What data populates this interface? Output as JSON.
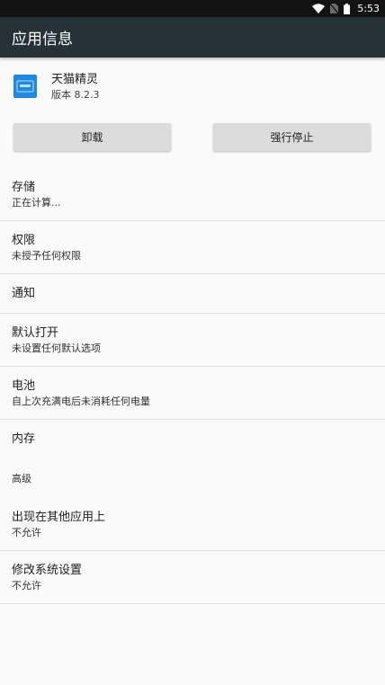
{
  "status_bar": {
    "time": "5:53",
    "icons": [
      "wifi-icon",
      "no-sim-icon",
      "battery-icon"
    ]
  },
  "app_bar": {
    "title": "应用信息"
  },
  "app": {
    "name": "天猫精灵",
    "version": "版本 8.2.3",
    "icon": "tmall-genie-icon",
    "icon_color": "#1e88e5"
  },
  "buttons": {
    "uninstall": "卸载",
    "force_stop": "强行停止"
  },
  "settings": {
    "storage": {
      "title": "存储",
      "subtitle": "正在计算..."
    },
    "permissions": {
      "title": "权限",
      "subtitle": "未授予任何权限"
    },
    "notifications": {
      "title": "通知"
    },
    "open_by_default": {
      "title": "默认打开",
      "subtitle": "未设置任何默认选项"
    },
    "battery": {
      "title": "电池",
      "subtitle": "自上次充满电后未消耗任何电量"
    },
    "memory": {
      "title": "内存"
    },
    "advanced": {
      "title": "高级"
    },
    "draw_over": {
      "title": "出现在其他应用上",
      "subtitle": "不允许"
    },
    "modify_system": {
      "title": "修改系统设置",
      "subtitle": "不允许"
    }
  },
  "colors": {
    "app_bar": "#263238",
    "status_bar": "#131313",
    "background": "#fafafa",
    "button": "#dcdcdc"
  }
}
